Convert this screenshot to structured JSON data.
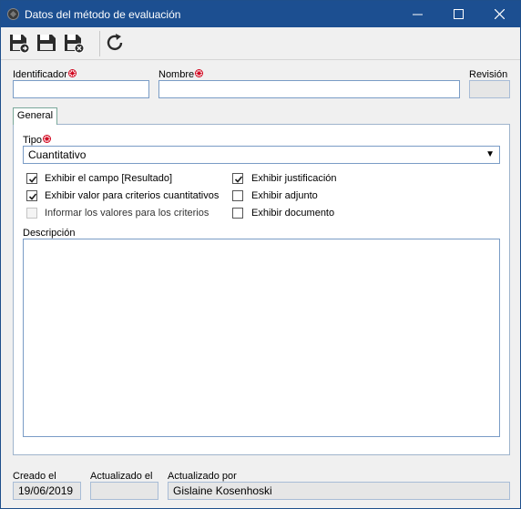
{
  "window": {
    "title": "Datos del método de evaluación"
  },
  "form": {
    "identificador_label": "Identificador",
    "identificador_value": "",
    "nombre_label": "Nombre",
    "nombre_value": "",
    "revision_label": "Revisión",
    "revision_value": ""
  },
  "tabs": [
    {
      "label": "General",
      "active": true
    }
  ],
  "general": {
    "tipo_label": "Tipo",
    "tipo_value": "Cuantitativo",
    "checkboxes_left": [
      {
        "label": "Exhibir el campo [Resultado]",
        "checked": true,
        "enabled": true
      },
      {
        "label": "Exhibir valor para criterios cuantitativos",
        "checked": true,
        "enabled": true
      },
      {
        "label": "Informar los valores para los criterios",
        "checked": false,
        "enabled": false
      }
    ],
    "checkboxes_right": [
      {
        "label": "Exhibir justificación",
        "checked": true,
        "enabled": true
      },
      {
        "label": "Exhibir adjunto",
        "checked": false,
        "enabled": true
      },
      {
        "label": "Exhibir documento",
        "checked": false,
        "enabled": true
      }
    ],
    "descripcion_label": "Descripción",
    "descripcion_value": ""
  },
  "footer": {
    "creado_label": "Creado el",
    "creado_value": "19/06/2019",
    "actualizado_label": "Actualizado el",
    "actualizado_value": "",
    "actualizado_por_label": "Actualizado por",
    "actualizado_por_value": "Gislaine Kosenhoski"
  },
  "icons": {
    "app": "app-icon",
    "save_new": "save-new-icon",
    "save": "save-icon",
    "save_close": "save-close-icon",
    "refresh": "refresh-icon",
    "required": "required-icon"
  },
  "colors": {
    "titlebar": "#1c4f91",
    "input_border": "#7a9cc6",
    "required": "#d0021b"
  }
}
